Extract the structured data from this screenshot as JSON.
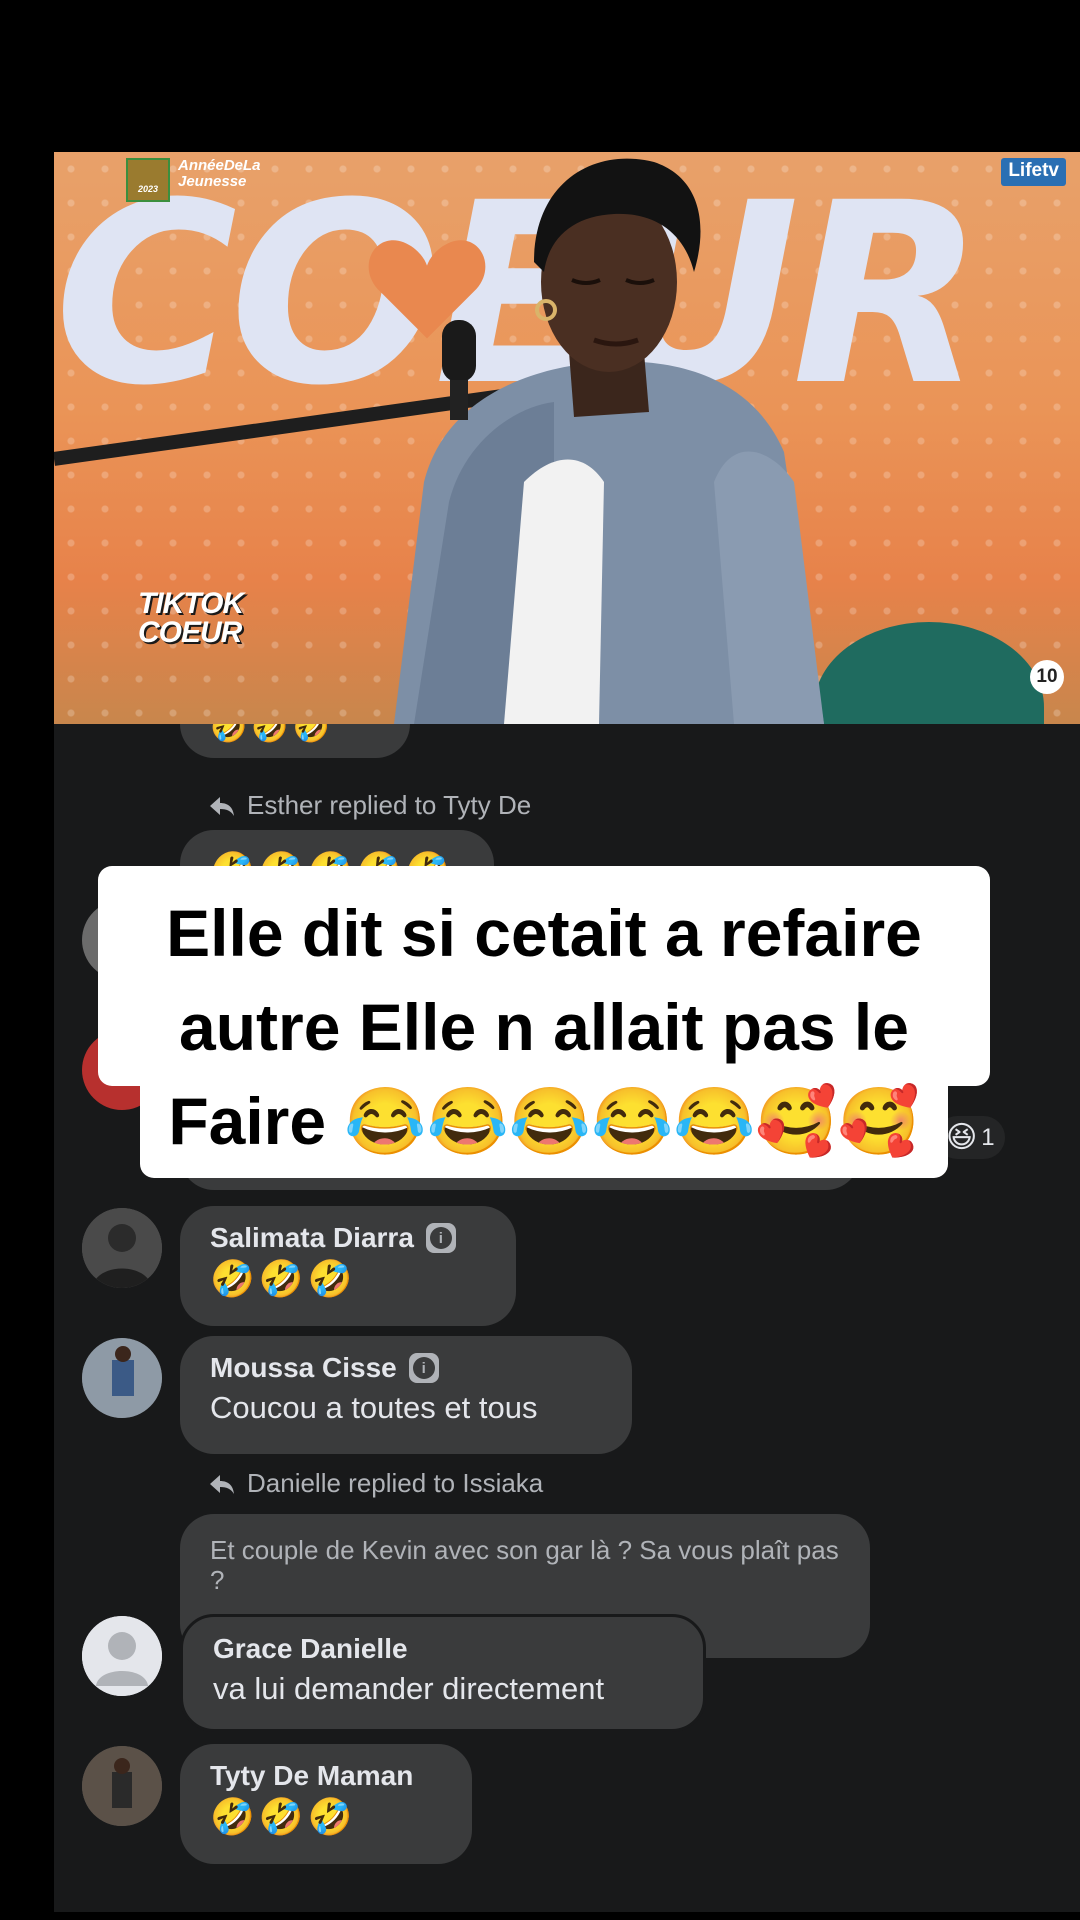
{
  "video": {
    "big_word": "COEUR",
    "logo_annee_line1": "AnnéeDeLa",
    "logo_annee_line2": "Jeunesse",
    "logo_annee_year": "2023",
    "logo_tiktok_line1": "TIKTOK",
    "logo_tiktok_line2": "COEUR",
    "logo_channel": "Lifetv",
    "logo_ten": "10"
  },
  "caption": {
    "text": "Elle dit si cetait a refaire autre Elle n allait pas le Faire 😂😂😂😂😂🥰🥰"
  },
  "chat": {
    "partial_top_emoji": "🤣🤣🤣",
    "reply1": {
      "text": "Esther replied to Tyty De",
      "emoji": "🤣🤣🤣🤣🤣🤣"
    },
    "hidden_reaction": {
      "emoji": "😆",
      "count": "1"
    },
    "comments": [
      {
        "name": "Salimata Diarra",
        "emoji": "🤣🤣🤣"
      },
      {
        "name": "Moussa Cisse",
        "text": "Coucou a toutes et tous"
      }
    ],
    "reply2": {
      "text": "Danielle replied to Issiaka",
      "quoted": "Et couple de Kevin avec son gar là ? Sa vous plaît pas ?"
    },
    "comments2": [
      {
        "name": "Grace Danielle",
        "text": "va lui demander directement"
      },
      {
        "name": "Tyty De Maman",
        "emoji": "🤣🤣🤣"
      }
    ],
    "colors": {
      "panel": "#18191a",
      "bubble": "#3a3b3c",
      "text": "#e4e6eb",
      "muted": "#b0b3b8"
    }
  }
}
